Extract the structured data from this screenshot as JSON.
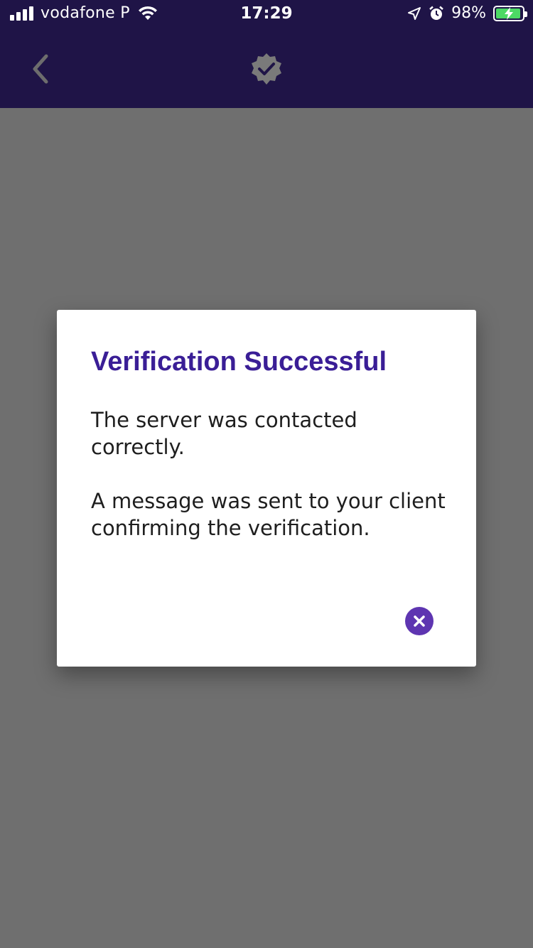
{
  "status_bar": {
    "carrier": "vodafone P",
    "time": "17:29",
    "battery_percent": "98%",
    "icons": [
      "signal-icon",
      "wifi-icon",
      "location-arrow-icon",
      "alarm-icon",
      "battery-charging-icon"
    ]
  },
  "app_bar": {
    "back_icon": "chevron-left-icon",
    "title_icon": "verified-badge-icon"
  },
  "dialog": {
    "title": "Verification Successful",
    "message_1": "The server was contacted correctly.",
    "message_2": "A message was sent to your client confirming the verification.",
    "close_icon": "close-circle-icon"
  },
  "colors": {
    "app_bar": "#1f1447",
    "overlay": "#6f6f6f",
    "title": "#3a1e96",
    "accent": "#5e35b1",
    "battery_fill": "#4cd964"
  }
}
